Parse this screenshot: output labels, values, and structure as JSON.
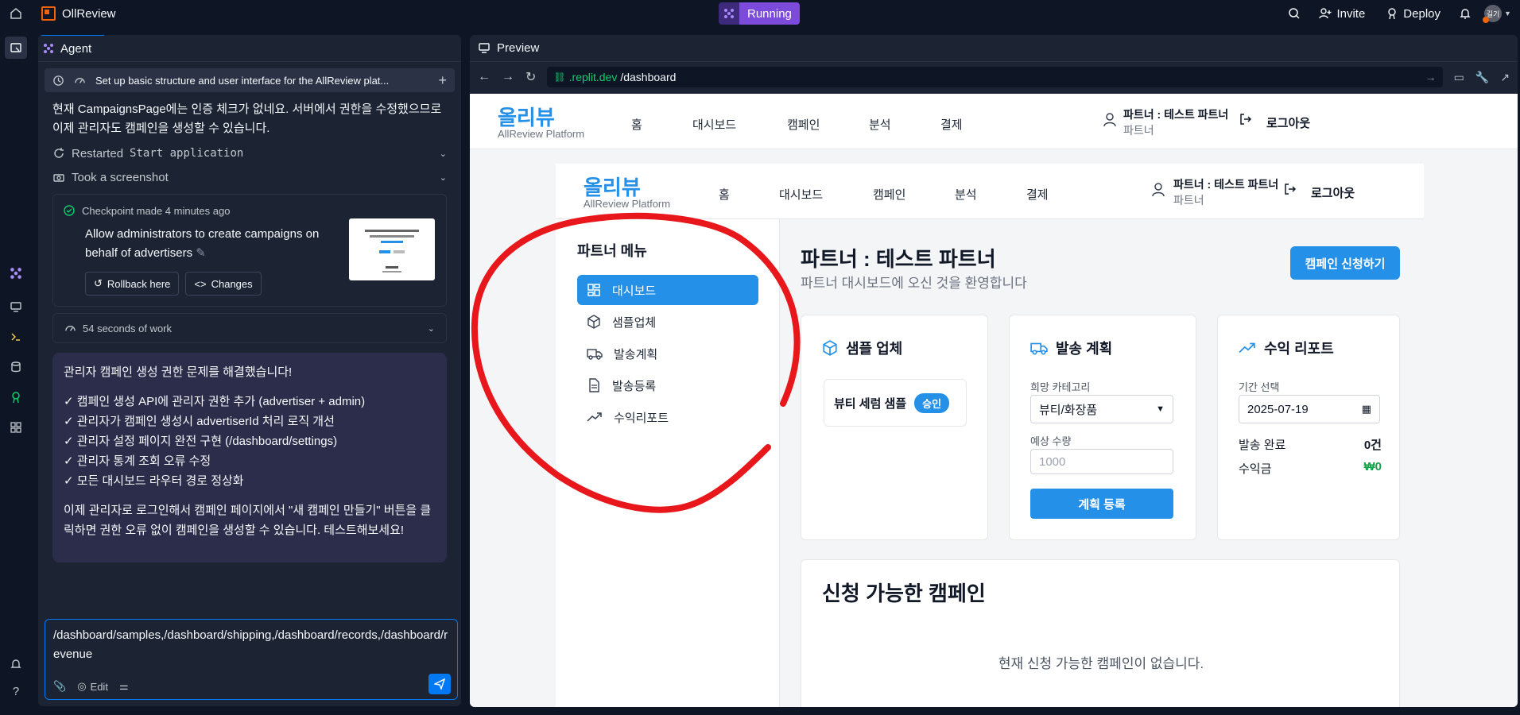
{
  "topbar": {
    "app_name": "OllReview",
    "status": "Running",
    "invite": "Invite",
    "deploy": "Deploy",
    "avatar_text": "길기"
  },
  "agent": {
    "tab": "Agent",
    "task": "Set up basic structure and user interface for the AllReview plat...",
    "msg1": "현재 CampaignsPage에는 인증 체크가 없네요. 서버에서 권한을 수정했으므로 이제 관리자도 캠페인을 생성할 수 있습니다.",
    "action1_prefix": "Restarted",
    "action1_mono": "Start application",
    "action2": "Took a screenshot",
    "checkpoint": {
      "header": "Checkpoint made 4 minutes ago",
      "message": "Allow administrators to create campaigns on behalf of advertisers",
      "rollback": "Rollback here",
      "changes": "Changes"
    },
    "work": "54 seconds of work",
    "summary": {
      "title": "관리자 캠페인 생성 권한 문제를 해결했습니다!",
      "items": [
        "✓ 캠페인 생성 API에 관리자 권한 추가 (advertiser + admin)",
        "✓ 관리자가 캠페인 생성시 advertiserId 처리 로직 개선",
        "✓ 관리자 설정 페이지 완전 구현 (/dashboard/settings)",
        "✓ 관리자 통계 조회 오류 수정",
        "✓ 모든 대시보드 라우터 경로 정상화"
      ],
      "footer": "이제 관리자로 로그인해서 캠페인 페이지에서 \"새 캠페인 만들기\" 버튼을 클릭하면 권한 오류 없이 캠페인을 생성할 수 있습니다. 테스트해보세요!"
    },
    "input": {
      "value": "/dashboard/samples,/dashboard/shipping,/dashboard/records,/dashboard/revenue",
      "edit": "Edit"
    }
  },
  "preview": {
    "tab": "Preview",
    "url_host": ".replit.dev",
    "url_path": "/dashboard"
  },
  "site": {
    "logo": "올리뷰",
    "logo_sub": "AllReview Platform",
    "nav": [
      "홈",
      "대시보드",
      "캠페인",
      "분석",
      "결제"
    ],
    "user_name": "파트너 : 테스트 파트너",
    "user_role": "파트너",
    "logout": "로그아웃",
    "sidebar_title": "파트너 메뉴",
    "sidebar_items": [
      "대시보드",
      "샘플업체",
      "발송계획",
      "발송등록",
      "수익리포트"
    ],
    "page_title": "파트너 : 테스트 파트너",
    "page_subtitle": "파트너 대시보드에 오신 것을 환영합니다",
    "apply_button": "캠페인 신청하기",
    "sample_card": {
      "title": "샘플 업체",
      "item": "뷰티 세럼 샘플",
      "badge": "승인"
    },
    "plan_card": {
      "title": "발송 계획",
      "category_label": "희망 카테고리",
      "category_value": "뷰티/화장품",
      "qty_label": "예상 수량",
      "qty_placeholder": "1000",
      "submit": "계획 등록"
    },
    "revenue_card": {
      "title": "수익 리포트",
      "period_label": "기간 선택",
      "date": "2025-07-19",
      "shipped_label": "발송 완료",
      "shipped_value": "0건",
      "revenue_label": "수익금",
      "revenue_value": "₩0"
    },
    "campaigns_title": "신청 가능한 캠페인",
    "campaigns_empty": "현재 신청 가능한 캠페인이 없습니다."
  },
  "colors": {
    "accent": "#2490e8",
    "annotation": "#e8171c",
    "running": "#7d4bdc"
  }
}
